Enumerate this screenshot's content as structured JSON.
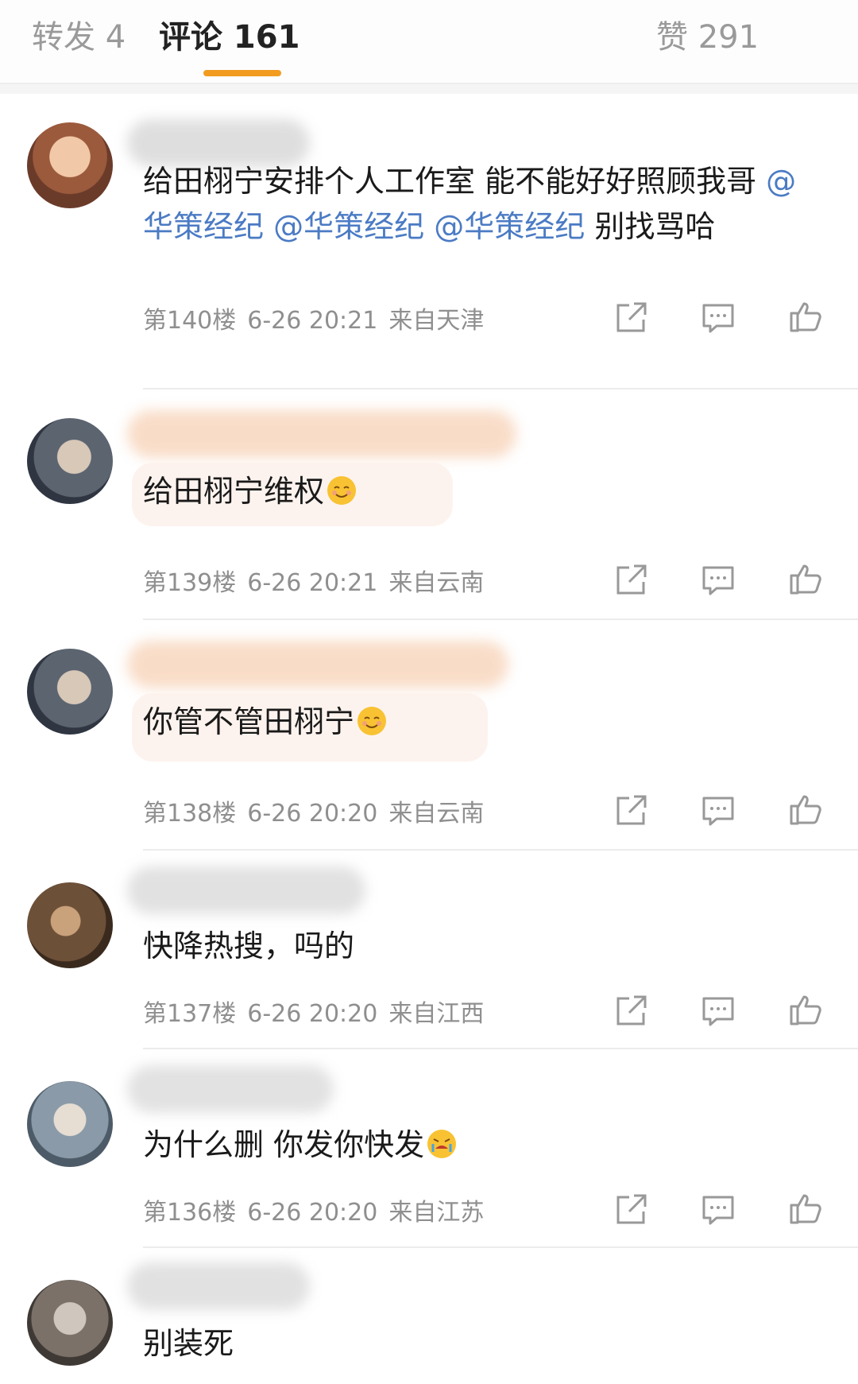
{
  "tabs": {
    "repost": "转发 4",
    "comments": "评论 161",
    "likes": "赞 291"
  },
  "colors": {
    "accent": "#f29c1f",
    "mention": "#4b7bc4",
    "meta": "#8f8f8f"
  },
  "icons": {
    "share": "share-icon",
    "reply": "reply-icon",
    "like": "like-icon",
    "smile": "smiling-face-emoji",
    "cry": "crying-face-emoji"
  },
  "comments": [
    {
      "text_before": "给田栩宁安排个人工作室 能不能好好照顾我哥 ",
      "mentions": [
        "@华策经纪",
        "@华策经纪",
        "@华策经纪"
      ],
      "text_after": " 别找骂哈",
      "floor": "第140楼",
      "time": "6-26 20:21",
      "location": "来自天津"
    },
    {
      "text": "给田栩宁维权",
      "emoji": "smiling-face-emoji",
      "floor": "第139楼",
      "time": "6-26 20:21",
      "location": "来自云南"
    },
    {
      "text": "你管不管田栩宁",
      "emoji": "smiling-face-emoji",
      "floor": "第138楼",
      "time": "6-26 20:20",
      "location": "来自云南"
    },
    {
      "text": "快降热搜，吗的",
      "floor": "第137楼",
      "time": "6-26 20:20",
      "location": "来自江西"
    },
    {
      "text": "为什么删  你发你快发",
      "emoji": "crying-face-emoji",
      "floor": "第136楼",
      "time": "6-26 20:20",
      "location": "来自江苏"
    },
    {
      "text": "别装死"
    }
  ]
}
